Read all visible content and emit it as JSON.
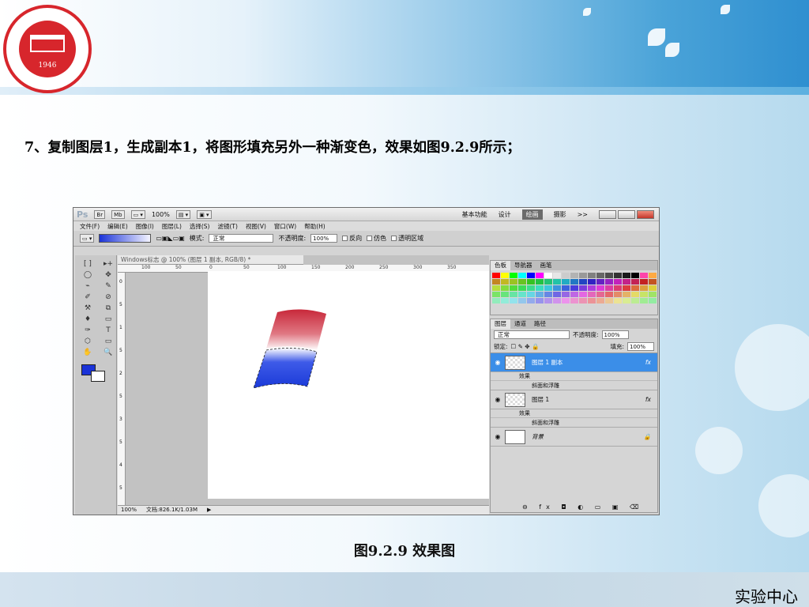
{
  "slide": {
    "heading": "7、复制图层1，生成副本1，将图形填充另外一种渐变色，效果如图9.2.9所示；",
    "caption": "图9.2.9 效果图",
    "footer_label": "实验中心",
    "logo": {
      "text": "CHINA WEST NORMAL UNIVERSITY",
      "year": "1946",
      "colors": {
        "ring": "#d7262c"
      }
    }
  },
  "photoshop": {
    "titlebar": {
      "app": "Ps",
      "btn_br": "Br",
      "btn_mb": "Mb",
      "zoom": "100%",
      "workspaces": [
        "基本功能",
        "设计",
        "绘画",
        "摄影"
      ],
      "active_workspace": "绘画",
      "more": ">>"
    },
    "menu": [
      "文件(F)",
      "编辑(E)",
      "图像(I)",
      "图层(L)",
      "选择(S)",
      "滤镜(T)",
      "视图(V)",
      "窗口(W)",
      "帮助(H)"
    ],
    "options": {
      "mode_label": "模式:",
      "mode_value": "正常",
      "opacity_label": "不透明度:",
      "opacity_value": "100%",
      "reverse_label": "反向",
      "dither_label": "仿色",
      "transparency_label": "透明区域"
    },
    "document": {
      "tab_title": "Windows标志 @ 100% (图层 1 副本, RGB/8) *",
      "status_zoom": "100%",
      "status_doc": "文档:826.1K/1.03M",
      "ruler_ticks": [
        "100",
        "50",
        "0",
        "50",
        "100",
        "150",
        "200",
        "250",
        "300",
        "350"
      ],
      "vruler_ticks": [
        "0",
        "5",
        "1",
        "5",
        "2",
        "5",
        "3",
        "5",
        "4",
        "5"
      ]
    },
    "tools": [
      "[ ]",
      "▸+",
      "◯",
      "✥",
      "⌁",
      "✎",
      "✐",
      "⊘",
      "⚒",
      "⧉",
      "♦",
      "▭",
      "✑",
      "T",
      "⬡",
      "▭",
      "✋",
      "🔍"
    ],
    "swatch_panel": {
      "tabs": [
        "色板",
        "导航器",
        "画笔"
      ]
    },
    "layers_panel": {
      "tabs": [
        "图层",
        "通道",
        "路径"
      ],
      "blend_mode": "正常",
      "opacity_label": "不透明度:",
      "opacity_value": "100%",
      "lock_label": "锁定:",
      "fill_label": "填充:",
      "fill_value": "100%",
      "layers": [
        {
          "name": "图层 1 副本",
          "selected": true,
          "effect_label": "效果",
          "effect_item": "斜面和浮雕"
        },
        {
          "name": "图层 1",
          "selected": false,
          "effect_label": "效果",
          "effect_item": "斜面和浮雕"
        },
        {
          "name": "背景",
          "selected": false
        }
      ],
      "fx_symbol": "fx"
    },
    "colors": {
      "foreground": "#1a33d8",
      "background": "#ffffff",
      "red_shape": "#c8283a",
      "blue_shape": "#1a3ad8",
      "selection": "#3b8ee8"
    }
  }
}
